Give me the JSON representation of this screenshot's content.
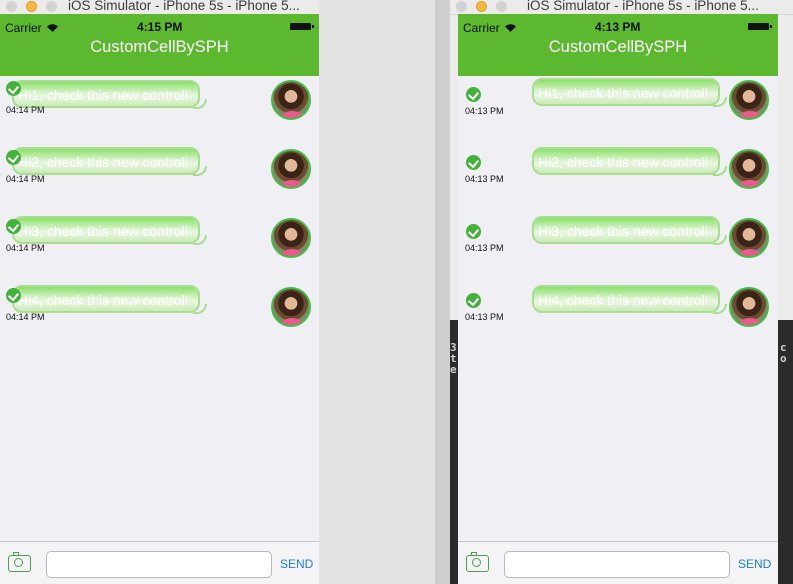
{
  "left_window": {
    "title": "iOS Simulator - iPhone 5s - iPhone 5...",
    "carrier": "Carrier",
    "clock": "4:15 PM",
    "nav_title": "CustomCellBySPH",
    "messages": [
      {
        "text": "Hi1, check this new control!",
        "time": "04:14 PM"
      },
      {
        "text": "Hi2, check this new control!",
        "time": "04:14 PM"
      },
      {
        "text": "Hi3, check this new control!",
        "time": "04:14 PM"
      },
      {
        "text": "Hi4, check this new control!",
        "time": "04:14 PM"
      }
    ],
    "input_placeholder": "",
    "send_label": "SEND"
  },
  "right_window": {
    "title": "iOS Simulator - iPhone 5s - iPhone 5...",
    "carrier": "Carrier",
    "clock": "4:13 PM",
    "nav_title": "CustomCellBySPH",
    "messages": [
      {
        "text": "Hi1, check this new control!",
        "time": "04:13 PM"
      },
      {
        "text": "Hi2, check this new control!",
        "time": "04:13 PM"
      },
      {
        "text": "Hi3, check this new control!",
        "time": "04:13 PM"
      },
      {
        "text": "Hi4, check this new control!",
        "time": "04:13 PM"
      }
    ],
    "input_placeholder": "",
    "send_label": "SEND"
  },
  "background_code": {
    "left_col": [
      "3",
      "t",
      "e"
    ],
    "right_col": [
      "c",
      "o"
    ]
  },
  "colors": {
    "nav_green": "#5cb82e",
    "bubble_green": "#8be06a",
    "check_green": "#43b23b",
    "send_blue": "#1a7af2",
    "traffic_yellow": "#f5b840"
  },
  "icons": {
    "close": "close-light",
    "minimize": "minimize-light",
    "zoom": "zoom-light",
    "wifi": "wifi-icon",
    "battery": "battery-icon",
    "check": "check-icon",
    "camera": "camera-icon",
    "avatar": "avatar-photo"
  }
}
